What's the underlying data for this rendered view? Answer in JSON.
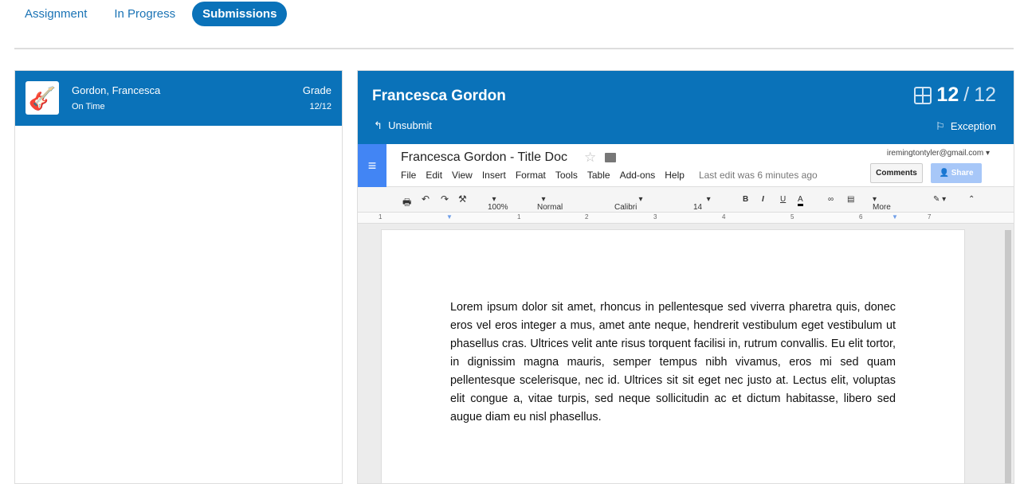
{
  "tabs": [
    {
      "label": "Assignment"
    },
    {
      "label": "In Progress"
    },
    {
      "label": "Submissions"
    }
  ],
  "list": {
    "name": "Gordon, Francesca",
    "status": "On Time",
    "grade_label": "Grade",
    "score": "12/12",
    "avatar_icon": "guitar-icon"
  },
  "submission": {
    "student": "Francesca Gordon",
    "unsubmit": "Unsubmit",
    "score": "12",
    "total": "12",
    "exception": "Exception"
  },
  "doc": {
    "title": "Francesca Gordon - Title Doc",
    "menus": [
      "File",
      "Edit",
      "View",
      "Insert",
      "Format",
      "Tools",
      "Table",
      "Add-ons",
      "Help"
    ],
    "last_edit": "Last edit was 6 minutes ago",
    "email": "iremingtontyler@gmail.com",
    "comments": "Comments",
    "share": "Share",
    "toolbar": {
      "zoom": "100%",
      "style": "Normal text",
      "font": "Calibri",
      "size": "14",
      "more": "More"
    },
    "ruler": [
      "1",
      "1",
      "2",
      "3",
      "4",
      "5",
      "6",
      "7"
    ],
    "body": "Lorem ipsum dolor sit amet, rhoncus in pellentesque sed viverra pharetra quis, donec eros vel eros integer a mus, amet ante neque, hendrerit vestibulum eget vestibulum ut phasellus cras. Ultrices velit ante risus torquent facilisi in, rutrum convallis. Eu elit tortor, in dignissim magna mauris, semper tempus nibh vivamus, eros mi sed quam pellentesque scelerisque, nec id. Ultrices sit sit eget nec justo at. Lectus elit, voluptas elit congue a, vitae turpis, sed neque sollicitudin ac et dictum habitasse, libero sed augue diam eu nisl phasellus."
  },
  "colors": {
    "primary": "#0a72b9",
    "docs_blue": "#4285f4"
  }
}
